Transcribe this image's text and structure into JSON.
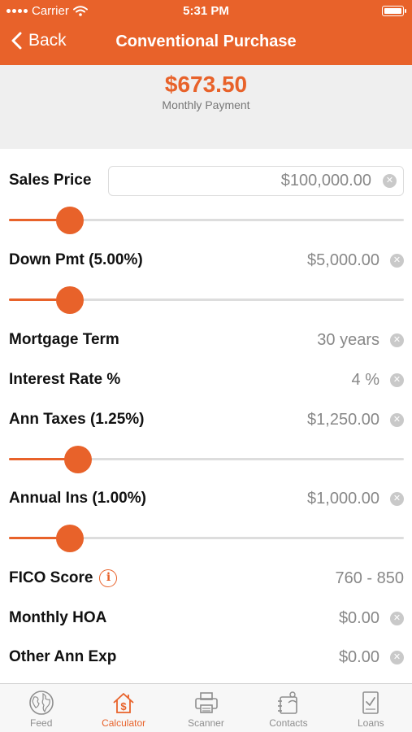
{
  "status_bar": {
    "carrier": "Carrier",
    "time": "5:31 PM"
  },
  "nav": {
    "back_label": "Back",
    "title": "Conventional Purchase"
  },
  "summary": {
    "amount": "$673.50",
    "label": "Monthly Payment"
  },
  "colors": {
    "accent": "#E8622A",
    "summary_bg": "#EFEFEF",
    "value_text": "#888888"
  },
  "fields": {
    "sales_price": {
      "label": "Sales Price",
      "value": "$100,000.00",
      "slider_level": 0.155
    },
    "down_pmt": {
      "label": "Down Pmt (5.00%)",
      "value": "$5,000.00",
      "slider_level": 0.155
    },
    "mortgage_term": {
      "label": "Mortgage Term",
      "value": "30 years"
    },
    "interest_rate": {
      "label": "Interest Rate %",
      "value": "4 %"
    },
    "ann_taxes": {
      "label": "Ann Taxes (1.25%)",
      "value": "$1,250.00",
      "slider_level": 0.175
    },
    "annual_ins": {
      "label": "Annual Ins (1.00%)",
      "value": "$1,000.00",
      "slider_level": 0.155
    },
    "fico_score": {
      "label": "FICO Score",
      "value": "760 - 850"
    },
    "monthly_hoa": {
      "label": "Monthly HOA",
      "value": "$0.00"
    },
    "other_ann_exp": {
      "label": "Other Ann Exp",
      "value": "$0.00"
    }
  },
  "tabs": [
    {
      "label": "Feed",
      "icon": "globe-icon",
      "active": false
    },
    {
      "label": "Calculator",
      "icon": "house-dollar-icon",
      "active": true
    },
    {
      "label": "Scanner",
      "icon": "printer-icon",
      "active": false
    },
    {
      "label": "Contacts",
      "icon": "contacts-icon",
      "active": false
    },
    {
      "label": "Loans",
      "icon": "document-check-icon",
      "active": false
    }
  ]
}
